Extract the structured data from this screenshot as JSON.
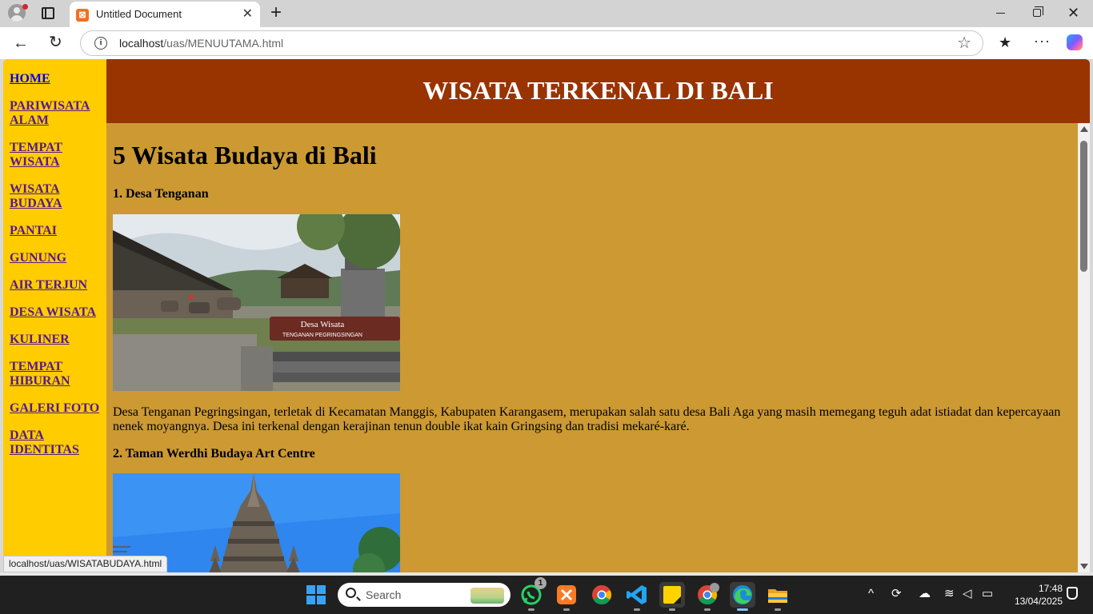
{
  "browser": {
    "tab": {
      "title": "Untitled Document",
      "favicon": "xampp-icon",
      "close": "✕"
    },
    "new_tab": "+",
    "address": {
      "host": "localhost",
      "path": "/uas/MENUUTAMA.html"
    },
    "window_controls": {
      "minimize": "minimize-icon",
      "maximize": "maximize-icon",
      "close": "✕"
    },
    "icons": {
      "back": "←",
      "reload": "↻",
      "star": "☆",
      "favorites": "★",
      "more": "···"
    }
  },
  "page": {
    "banner_title": "WISATA TERKENAL DI BALI",
    "nav": [
      {
        "label": "HOME",
        "current": true
      },
      {
        "label": "PARIWISATA ALAM"
      },
      {
        "label": "TEMPAT WISATA"
      },
      {
        "label": "WISATA BUDAYA"
      },
      {
        "label": "PANTAI"
      },
      {
        "label": "GUNUNG"
      },
      {
        "label": "AIR TERJUN"
      },
      {
        "label": "DESA WISATA"
      },
      {
        "label": "KULINER"
      },
      {
        "label": "TEMPAT HIBURAN"
      },
      {
        "label": "GALERI FOTO"
      },
      {
        "label": "DATA IDENTITAS"
      }
    ],
    "heading": "5 Wisata Budaya di Bali",
    "sections": [
      {
        "title": "1. Desa Tenganan",
        "photo_sign_line1": "Desa Wisata",
        "photo_sign_line2": "TENGANAN PEGRINGSINGAN",
        "description": "Desa Tenganan Pegringsingan, terletak di Kecamatan Manggis, Kabupaten Karangasem, merupakan salah satu desa Bali Aga yang masih memegang teguh adat istiadat dan kepercayaan nenek moyangnya. Desa ini terkenal dengan kerajinan tenun double ikat kain Gringsing dan tradisi mekaré-karé."
      },
      {
        "title": "2. Taman Werdhi Budaya Art Centre"
      }
    ],
    "status_url": "localhost/uas/WISATABUDAYA.html",
    "colors": {
      "sidebar": "#ffcc00",
      "banner": "#993300",
      "content_bg": "#cc9933"
    }
  },
  "taskbar": {
    "search_placeholder": "Search",
    "whatsapp_badge": "1",
    "clock_time": "17:48",
    "clock_date": "13/04/2025",
    "apps": [
      "start-icon",
      "whatsapp-icon",
      "xampp-icon",
      "chrome-icon",
      "vscode-icon",
      "sticky-notes-icon",
      "chrome-profile-icon",
      "edge-icon",
      "file-explorer-icon"
    ]
  }
}
